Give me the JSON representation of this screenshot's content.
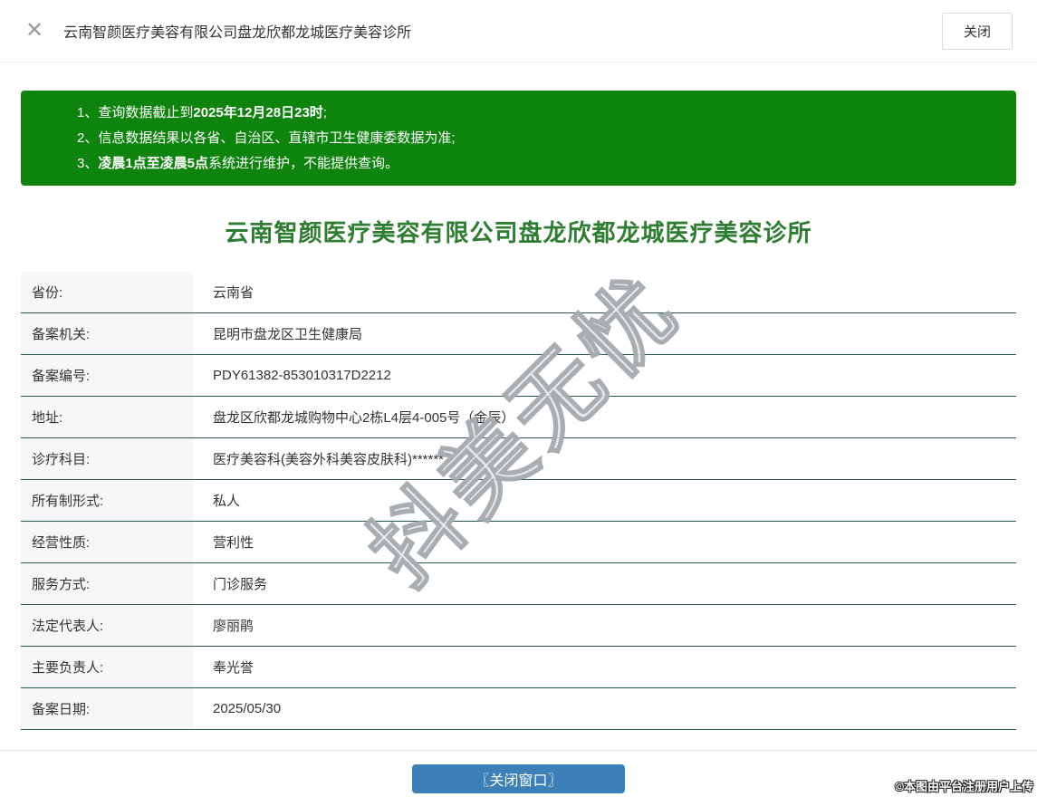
{
  "header": {
    "close_icon": "✕",
    "title": "云南智颜医疗美容有限公司盘龙欣都龙城医疗美容诊所",
    "close_button_label": "关闭"
  },
  "notice": {
    "items": [
      {
        "num": "1、",
        "pre": "查询数据截止到",
        "bold": "2025年12月28日23时",
        "post": ";"
      },
      {
        "num": "2、",
        "pre": "信息数据结果以各省、自治区、直辖市卫生健康委数据为准;",
        "bold": "",
        "post": ""
      },
      {
        "num": "3、",
        "pre": "",
        "bold": "凌晨1点至凌晨5点",
        "post": "系统进行维护，不能提供查询。"
      }
    ]
  },
  "main": {
    "title": "云南智颜医疗美容有限公司盘龙欣都龙城医疗美容诊所"
  },
  "table": {
    "rows": [
      {
        "label": "省份:",
        "value": "云南省"
      },
      {
        "label": "备案机关:",
        "value": "昆明市盘龙区卫生健康局"
      },
      {
        "label": "备案编号:",
        "value": "PDY61382-853010317D2212"
      },
      {
        "label": "地址:",
        "value": "盘龙区欣都龙城购物中心2栋L4层4-005号（金辰）"
      },
      {
        "label": "诊疗科目:",
        "value": "医疗美容科(美容外科美容皮肤科)******"
      },
      {
        "label": "所有制形式:",
        "value": "私人"
      },
      {
        "label": "经营性质:",
        "value": "营利性"
      },
      {
        "label": "服务方式:",
        "value": "门诊服务"
      },
      {
        "label": "法定代表人:",
        "value": "廖丽鹃"
      },
      {
        "label": "主要负责人:",
        "value": "奉光誉"
      },
      {
        "label": "备案日期:",
        "value": "2025/05/30"
      }
    ]
  },
  "footer": {
    "close_window_label": "〖关闭窗口〗"
  },
  "watermarks": {
    "diagonal": "抖美无忧",
    "copyright": "©本图由平台注册用户上传"
  },
  "colors": {
    "notice_green": "#0e840e",
    "title_green": "#2e7d32",
    "row_divider_green": "#265c4a",
    "button_blue": "#3c80b7",
    "label_cell_bg": "#f7f7f7"
  }
}
